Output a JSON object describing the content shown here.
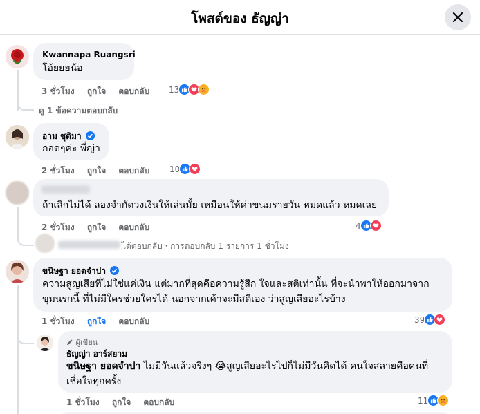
{
  "header": {
    "title": "โพสต์ของ ธัญญ่า"
  },
  "colors": {
    "accent": "#1877f2",
    "love": "#f33e58",
    "care": "#f7b125"
  },
  "comments": [
    {
      "name": "Kwannapa Ruangsri",
      "text": "โอ้ยยยน้อ",
      "time": "3 ชั่วโมง",
      "like": "ถูกใจ",
      "reply": "ตอบกลับ",
      "count": "13",
      "view_replies": "ดู 1 ข้อความตอบกลับ"
    },
    {
      "name": "อาม ชุติมา",
      "text": "กอดๆค่ะ พี่ญ่า",
      "time": "2 ชั่วโมง",
      "like": "ถูกใจ",
      "reply": "ตอบกลับ",
      "count": "10"
    },
    {
      "text": "ถ้าเลิกไม่ได้ ลองจำกัดวงเงินให้เล่นมั้ย เหมือนให้ค่าขนมรายวัน หมดแล้ว หมดเลย",
      "time": "2 ชั่วโมง",
      "like": "ถูกใจ",
      "reply": "ตอบกลับ",
      "count": "4",
      "reply_summary": "ได้ตอบกลับ · การตอบกลับ 1 รายการ 1 ชั่วโมง"
    },
    {
      "name": "ขนิษฐา ยอดจำปา",
      "text_line1": "ความสูญเสียที่ไม่ใช่แค่เงิน แต่มากที่สุดคือความรู้สึก ใจและสติเท่านั้น ที่จะนำพาให้ออกมาจาก",
      "text_line2": "ขุมนรกนี้ ที่ไม่มีใครช่วยใครได้ นอกจากเค้าจะมีสติเอง ว่าสูญเสียอะไรบ้าง",
      "time": "1 ชั่วโมง",
      "like": "ถูกใจ",
      "reply": "ตอบกลับ",
      "count": "39"
    }
  ],
  "author_reply": {
    "badge": "ผู้เขียน",
    "name": "ธัญญ่า อาร์สยาม",
    "mention": "ขนิษฐา ยอดจำปา",
    "line1_rest": " ไม่มีวันแล้วจริงๆ 😭สูญเสียอะไรไปก็ไม่มีวันคิดได้ คนใจสลายคือคนที่",
    "line2": "เชื่อใจทุกครั้ง",
    "time": "1 ชั่วโมง",
    "like": "ถูกใจ",
    "reply": "ตอบกลับ",
    "count": "11"
  }
}
